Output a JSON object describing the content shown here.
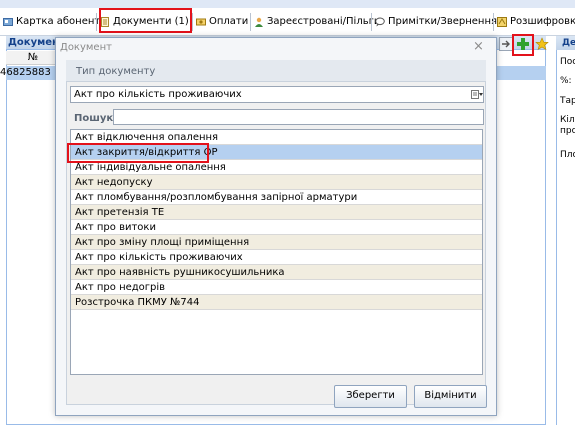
{
  "tabs": [
    {
      "label": "Картка абонента",
      "icon": "card-icon"
    },
    {
      "label": "Документи (1)",
      "icon": "document-icon"
    },
    {
      "label": "Оплати",
      "icon": "money-icon"
    },
    {
      "label": "Зареєстровані/Пільги",
      "icon": "users-icon"
    },
    {
      "label": "Примітки/Звернення",
      "icon": "comment-icon"
    },
    {
      "label": "Розшифровка",
      "icon": "decode-icon"
    }
  ],
  "doc_panel": {
    "title": "Документ",
    "column_number": "№",
    "row_code": "46825883"
  },
  "right_pane": {
    "title": "Де",
    "lines": [
      "Пос",
      "%:",
      "Тар",
      "Кіл",
      "про",
      "Пло"
    ]
  },
  "toolbar": {
    "icons": [
      "arrow-right-icon",
      "add-icon",
      "star-icon"
    ]
  },
  "dialog": {
    "title": "Документ",
    "close_glyph": "×",
    "group_label": "Тип документу",
    "selected_type": "Акт про кількість проживаючих",
    "search_label": "Пошук:",
    "search_value": "",
    "items": [
      "Акт відключення опалення",
      "Акт закриття/відкриття ОР",
      "Акт індивідуальне опалення",
      "Акт недопуску",
      "Акт пломбування/розпломбування запірної арматури",
      "Акт претензія ТЕ",
      "Акт про витоки",
      "Акт про зміну площі приміщення",
      "Акт про кількість проживаючих",
      "Акт про наявність рушникосушильника",
      "Акт про недогрів",
      "Розстрочка ПКМУ №744"
    ],
    "save_label": "Зберегти",
    "cancel_label": "Відмінити"
  },
  "colors": {
    "highlight_red": "#e3121b",
    "selection_blue": "#b5d0f0",
    "alt_row": "#f1ede0",
    "panel_border": "#99bbe8"
  }
}
